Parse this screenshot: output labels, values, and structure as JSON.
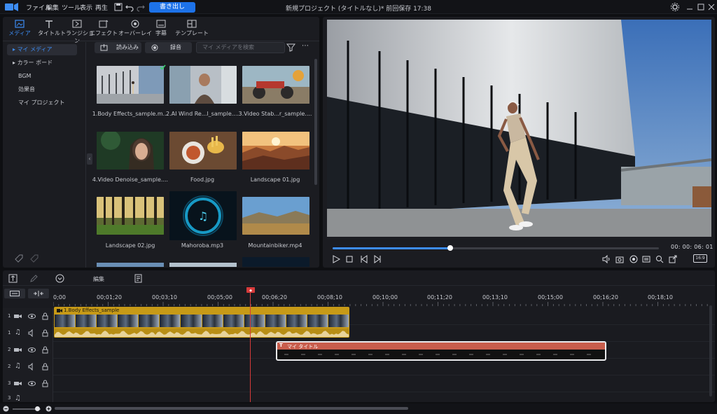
{
  "app": {
    "title": "新規プロジェクト (タイトルなし)* 前回保存 17:38",
    "export_label": "書き出し",
    "menu": [
      "ファイル",
      "編集",
      "ツール",
      "表示",
      "再生"
    ]
  },
  "library": {
    "tabs": [
      "メディア",
      "タイトル",
      "トランジション",
      "エフェクト",
      "オーバーレイ",
      "字幕",
      "テンプレート"
    ],
    "active_tab": "メディア",
    "nav": [
      "マイ メディア",
      "カラー ボード",
      "BGM",
      "効果音",
      "マイ プロジェクト"
    ],
    "import_label": "読み込み",
    "record_label": "録音",
    "search_placeholder": "マイ メディアを検索",
    "items": [
      {
        "caption": "1.Body Effects_sample.m...",
        "kind": "video-building"
      },
      {
        "caption": "2.AI Wind Re...l_sample....",
        "kind": "video-woman"
      },
      {
        "caption": "3.Video Stab...r_sample....",
        "kind": "video-bikes"
      },
      {
        "caption": "4.Video Denoise_sample....",
        "kind": "video-portrait"
      },
      {
        "caption": "Food.jpg",
        "kind": "image-food"
      },
      {
        "caption": "Landscape 01.jpg",
        "kind": "image-canyon"
      },
      {
        "caption": "Landscape 02.jpg",
        "kind": "image-forest"
      },
      {
        "caption": "Mahoroba.mp3",
        "kind": "audio"
      },
      {
        "caption": "Mountainbiker.mp4",
        "kind": "video-mountain"
      }
    ]
  },
  "preview": {
    "timecode": "00: 00: 06: 01",
    "progress": 0.36,
    "aspect": "16:9"
  },
  "timeline": {
    "edit_label": "編集",
    "ruler": [
      "0;00",
      "00;01;20",
      "00;03;10",
      "00;05;00",
      "00;06;20",
      "00;08;10",
      "00;10;00",
      "00;11;20",
      "00;13;10",
      "00;15;00",
      "00;16;20",
      "00;18;10"
    ],
    "tracks": [
      "1",
      "1",
      "2",
      "2",
      "3",
      "3"
    ],
    "clip_video_name": "1.Body Effects_sample",
    "title_clip_name": "マイ タイトル"
  }
}
